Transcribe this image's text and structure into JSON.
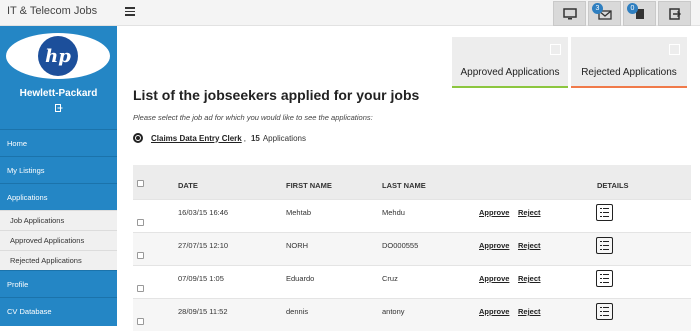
{
  "header": {
    "brand": "IT & Telecom Jobs",
    "badges": {
      "messages": "3",
      "documents": "0"
    }
  },
  "sidebar": {
    "company": "Hewlett-Packard",
    "logo_text": "hp",
    "items": [
      {
        "label": "Home"
      },
      {
        "label": "My Listings"
      },
      {
        "label": "Applications"
      }
    ],
    "subitems": [
      {
        "label": "Job Applications"
      },
      {
        "label": "Approved Applications"
      },
      {
        "label": "Rejected Applications"
      }
    ],
    "items_after": [
      {
        "label": "Profile"
      },
      {
        "label": "CV Database"
      }
    ]
  },
  "cards": {
    "approved": "Approved Applications",
    "rejected": "Rejected Applications",
    "approved_color": "#8cc63f",
    "rejected_color": "#f07a4a"
  },
  "main": {
    "heading": "List of the jobseekers applied for your jobs",
    "hint": "Please select the job ad for which you would like to see the applications:",
    "job": {
      "title": "Claims Data Entry Clerk",
      "separator": ",",
      "count": "15",
      "count_label": "Applications"
    }
  },
  "table": {
    "headers": {
      "date": "DATE",
      "first": "FIRST NAME",
      "last": "LAST NAME",
      "details": "DETAILS"
    },
    "approve_label": "Approve",
    "reject_label": "Reject",
    "rows": [
      {
        "date": "16/03/15 16:46",
        "first": "Mehtab",
        "last": "Mehdu"
      },
      {
        "date": "27/07/15 12:10",
        "first": "NORH",
        "last": "DO000555"
      },
      {
        "date": "07/09/15 1:05",
        "first": "Eduardo",
        "last": "Cruz"
      },
      {
        "date": "28/09/15 11:52",
        "first": "dennis",
        "last": "antony"
      }
    ]
  }
}
